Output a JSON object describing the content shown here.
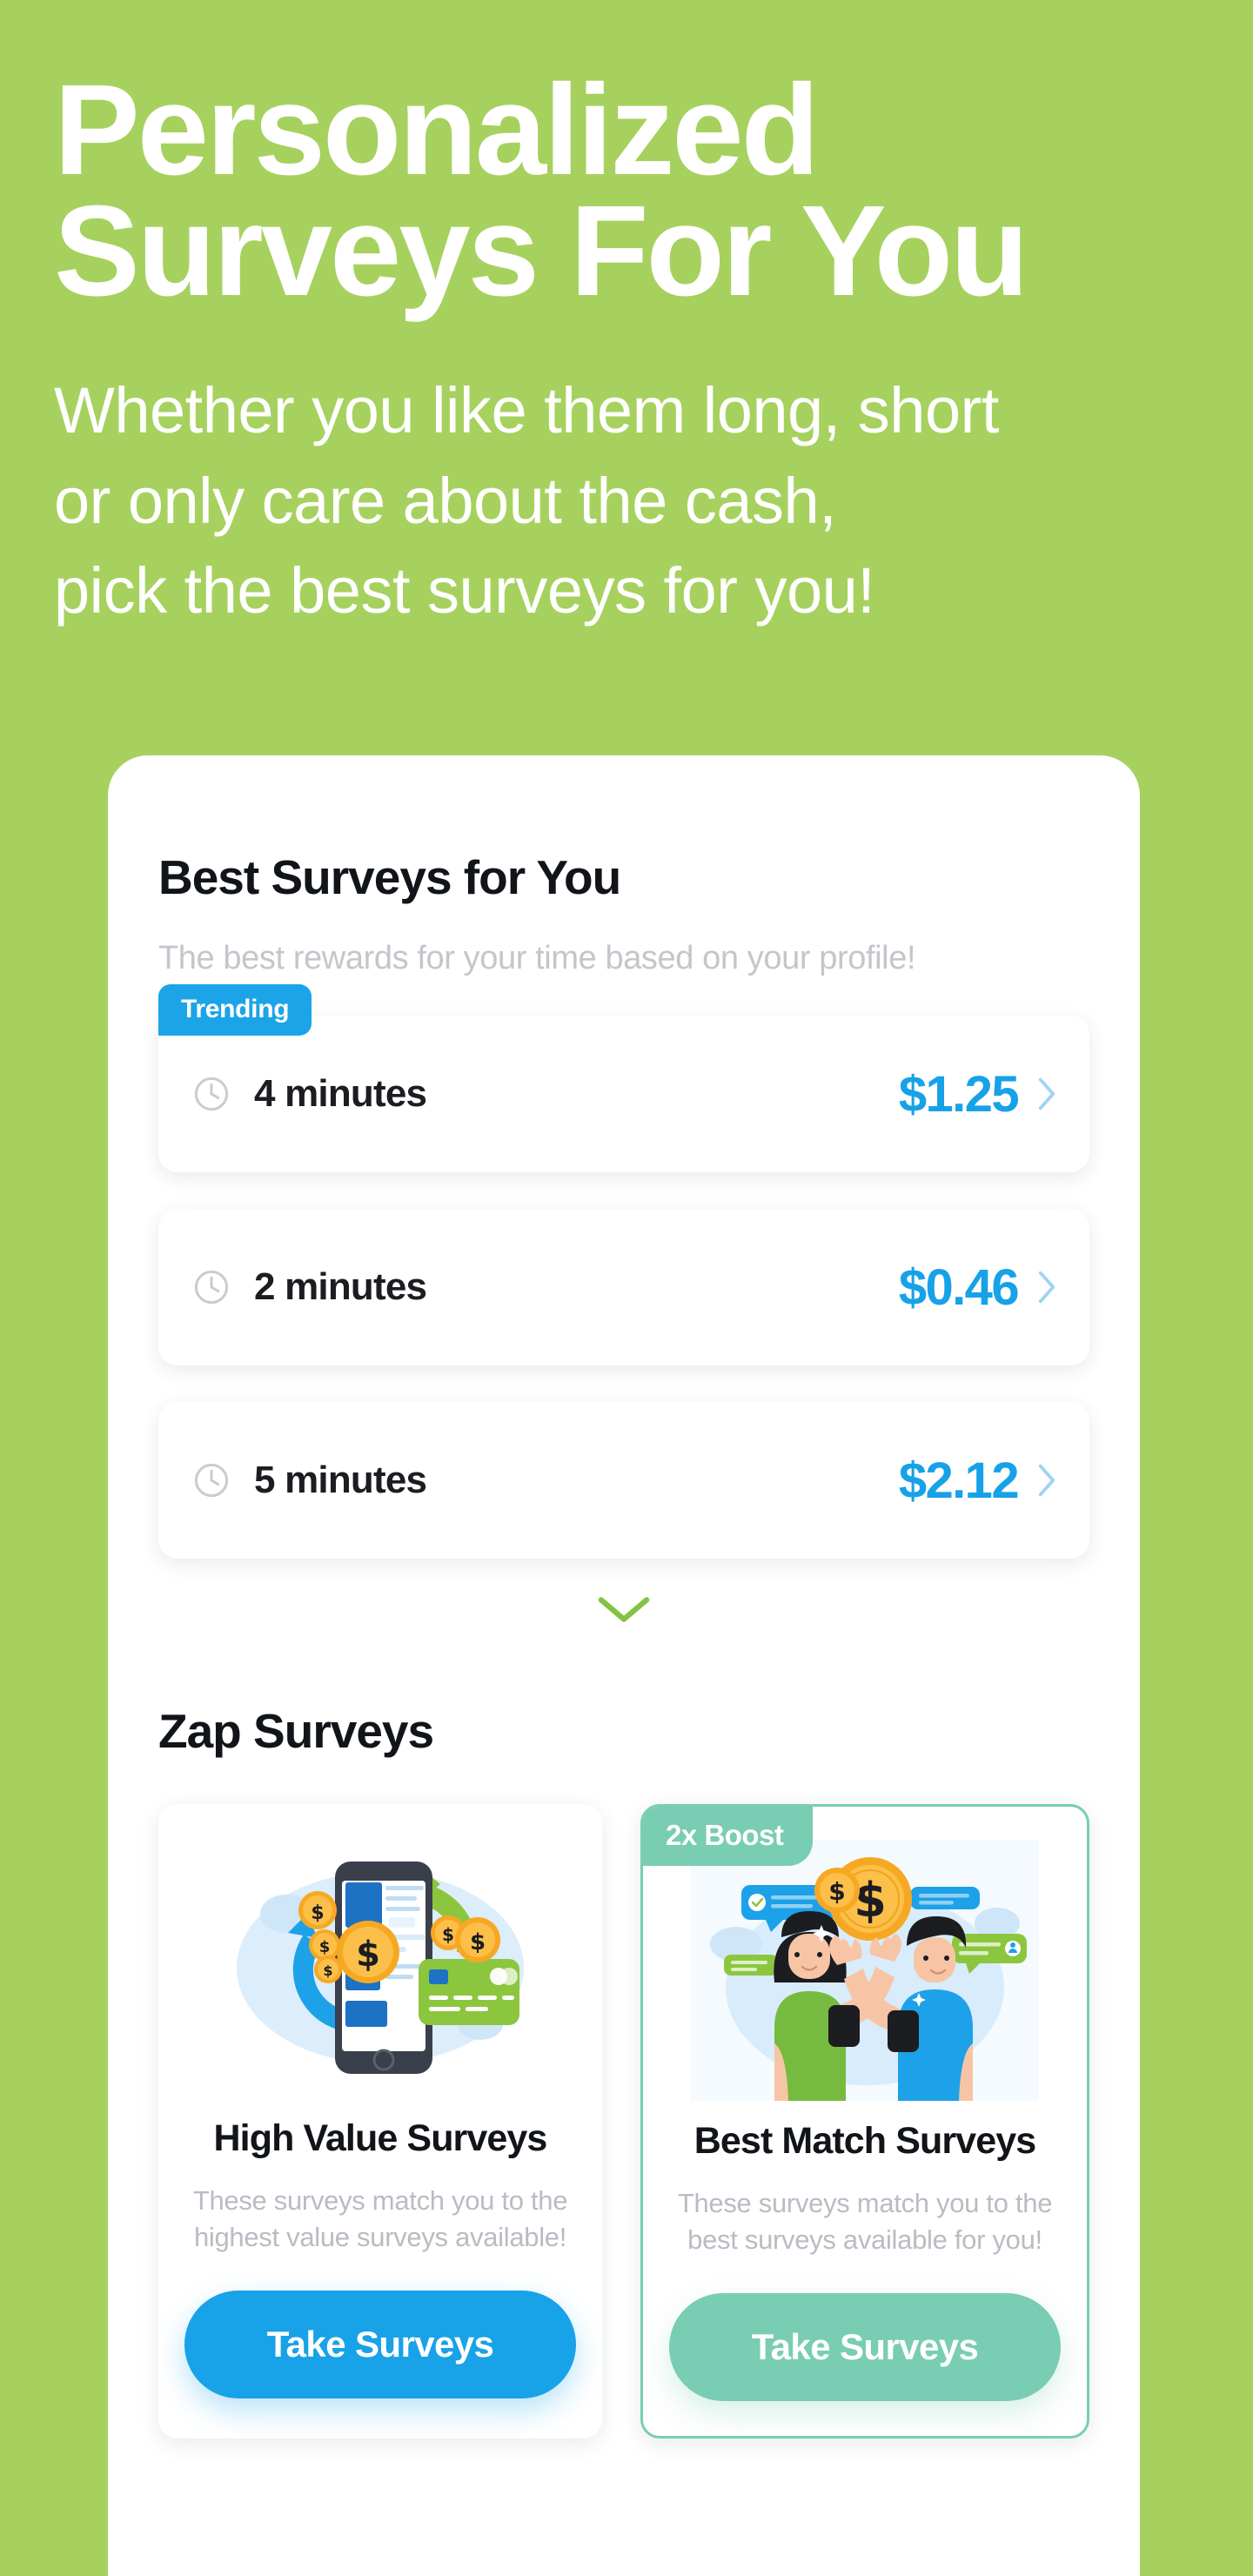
{
  "hero": {
    "title": "Personalized\nSurveys For You",
    "subtitle": "Whether you like them long, short\nor only care about the cash,\npick the best surveys for you!",
    "background_color": "#a6d15e",
    "text_color": "#ffffff"
  },
  "panel": {
    "title": "Best Surveys for You",
    "subtitle": "The best rewards for your time based on your profile!",
    "badge_trending": "Trending",
    "surveys": [
      {
        "duration": "4 minutes",
        "reward": "$1.25",
        "badge": "Trending",
        "icon": "clock-icon",
        "chevron": "chevron-right-icon"
      },
      {
        "duration": "2 minutes",
        "reward": "$0.46",
        "badge": "",
        "icon": "clock-icon",
        "chevron": "chevron-right-icon"
      },
      {
        "duration": "5 minutes",
        "reward": "$2.12",
        "badge": "",
        "icon": "clock-icon",
        "chevron": "chevron-right-icon"
      }
    ],
    "expand_icon": "chevron-down-icon",
    "expand_icon_color": "#82c341",
    "reward_color": "#17a2e8",
    "badge_color": "#1ba4e8"
  },
  "zap": {
    "title": "Zap Surveys",
    "cards": [
      {
        "badge": "",
        "title": "High Value Surveys",
        "description": "These surveys match you to the\nhighest value surveys available!",
        "button_label": "Take Surveys",
        "button_color": "#18a2e8",
        "art": "phone-coins-credit-card-illustration"
      },
      {
        "badge": "2x Boost",
        "title": "Best Match Surveys",
        "description": "These surveys match you to the\nbest surveys available for you!",
        "button_label": "Take Surveys",
        "button_color": "#79cdb2",
        "art": "two-people-high-five-coin-illustration"
      }
    ]
  }
}
